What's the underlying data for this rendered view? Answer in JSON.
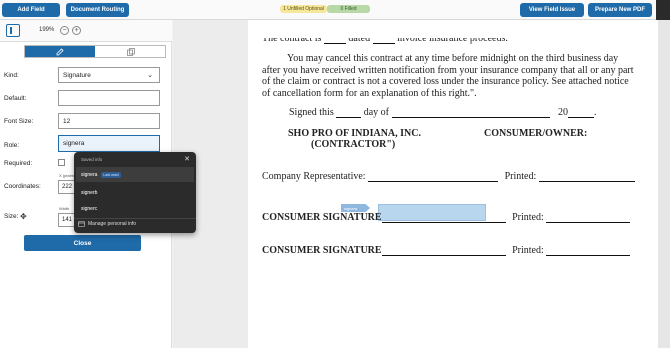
{
  "toolbar": {
    "add_field": "Add Field",
    "document_routing": "Document Routing",
    "unfilled_optional": "1 Unfilled Optional",
    "filled": "0 Filled",
    "view_field_issue": "View Field Issue",
    "prepare_new_pdf": "Prepare New PDF",
    "colors": {
      "primary": "#1f6aa8",
      "unfilled": "#f6e79c",
      "filled": "#b8d8a8"
    }
  },
  "zoom": {
    "value": "199%",
    "minus": "−",
    "plus": "+"
  },
  "panel": {
    "kind_label": "Kind:",
    "kind_value": "Signature",
    "default_label": "Default:",
    "default_value": "",
    "font_size_label": "Font Size:",
    "font_size_value": "12",
    "role_label": "Role:",
    "role_value": "signera",
    "required_label": "Required:",
    "coordinates_label": "Coordinates:",
    "x_label": "X (pixels)",
    "x_value": "222",
    "size_label": "Size:",
    "width_label": "Width",
    "width_value": "141",
    "close_label": "Close"
  },
  "autofill": {
    "header": "Saved info",
    "items": [
      {
        "label": "signera",
        "badge": "Last used"
      },
      {
        "label": "signerb"
      },
      {
        "label": "signerc"
      }
    ],
    "manage": "Manage personal info"
  },
  "document": {
    "line1_pre": "The contract is",
    "line1_mid": "dated",
    "line1_post": "invoice insurance proceeds.",
    "paragraph": "You may cancel this contract at any time before midnight on the third business day after you have received written notification from your insurance company that all or any part of the claim or contract is not a covered loss under the insurance policy. See attached notice of cancellation form for an explanation of this right.\".",
    "signed_this": "Signed this",
    "day_of": "day of",
    "year": "20",
    "contractor_name": "SHO PRO OF INDIANA, INC.",
    "contractor_role": "(CONTRACTOR\")",
    "consumer_owner": "CONSUMER/OWNER:",
    "company_rep": "Company Representative:",
    "printed": "Printed:",
    "consumer_signature": "CONSUMER SIGNATURE",
    "field_tag": "signera"
  }
}
